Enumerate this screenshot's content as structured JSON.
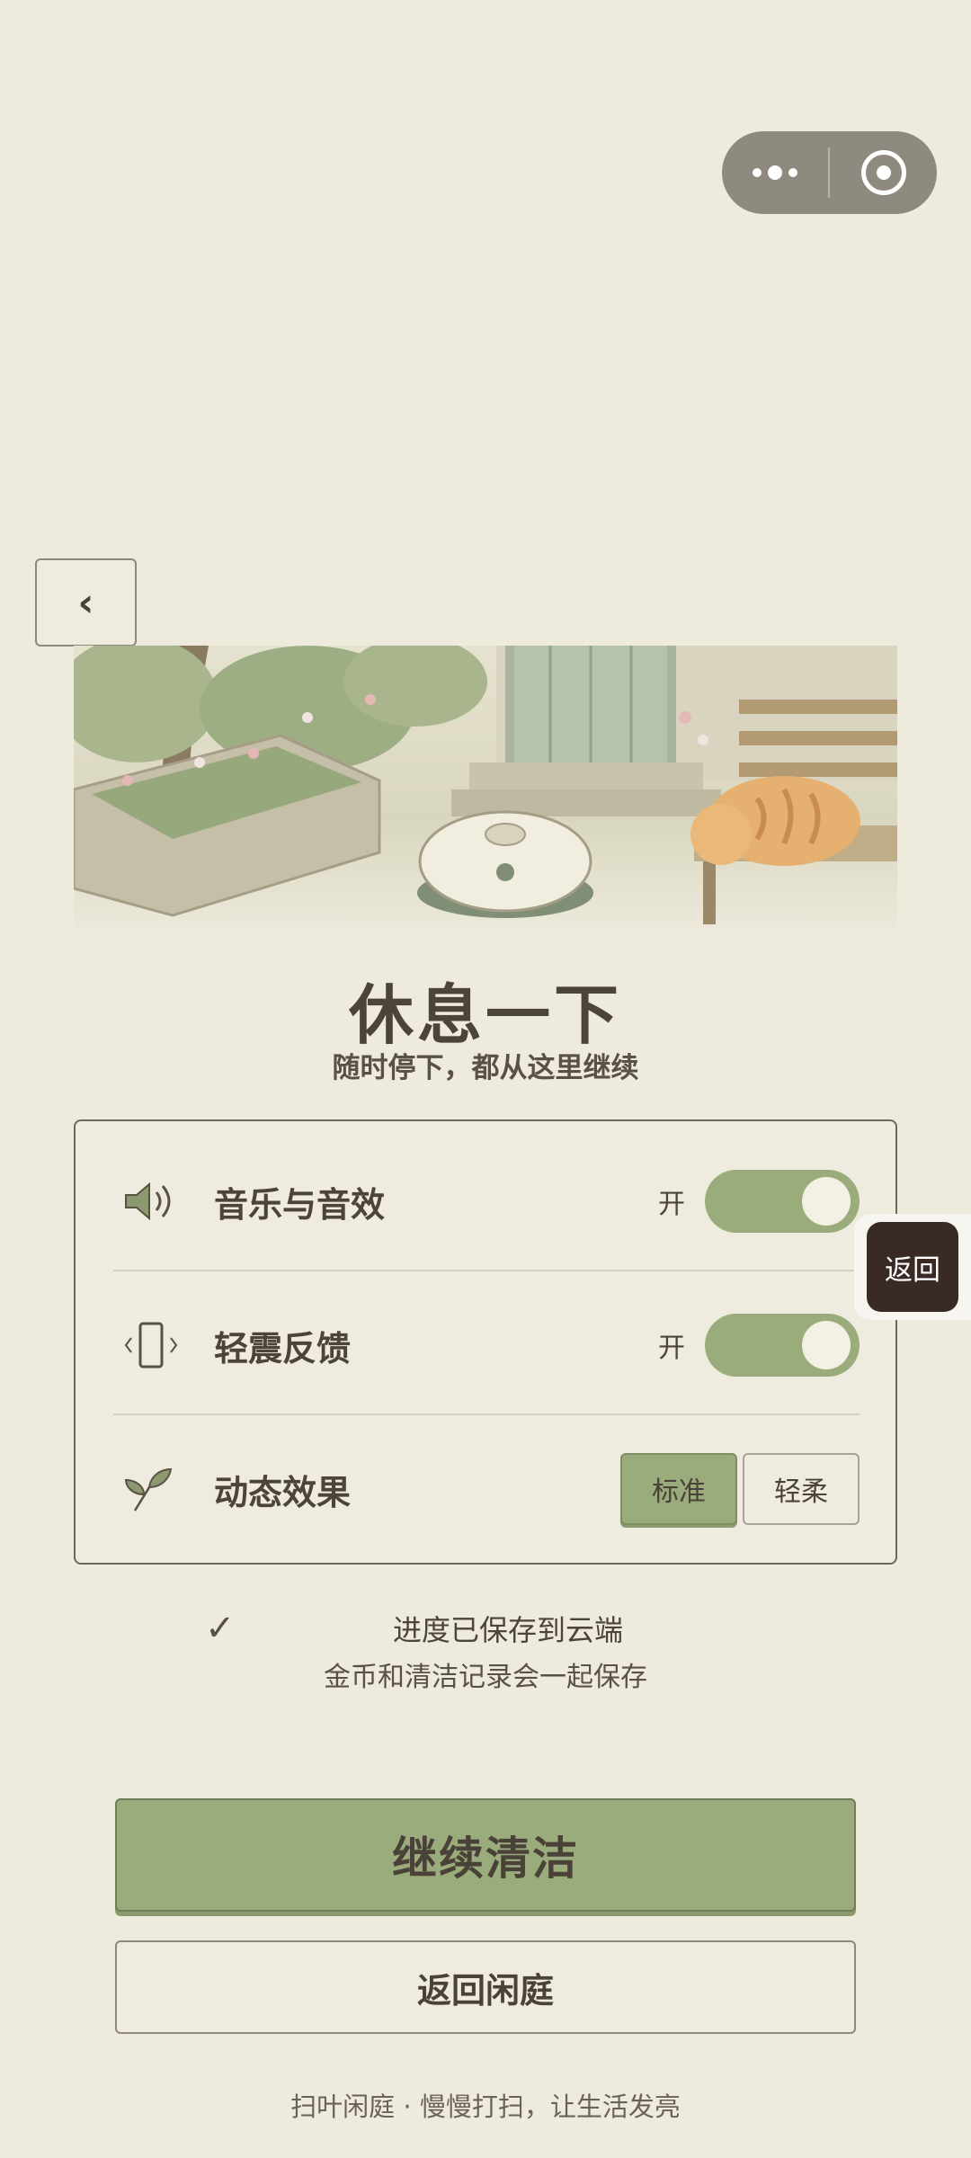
{
  "capsule": {
    "more_icon": "more-dots-icon",
    "close_icon": "target-circle-icon"
  },
  "back_button": {
    "label": "‹"
  },
  "title": "休息一下",
  "subtitle": "随时停下，都从这里继续",
  "settings": {
    "music": {
      "label": "音乐与音效",
      "state": "开",
      "on": true
    },
    "haptics": {
      "label": "轻震反馈",
      "state": "开",
      "on": true
    },
    "motion": {
      "label": "动态效果",
      "options": [
        "标准",
        "轻柔"
      ],
      "selected": "标准"
    }
  },
  "floating_back": {
    "label": "返回"
  },
  "save_status": {
    "check": "✓",
    "main": "进度已保存到云端",
    "sub": "金币和清洁记录会一起保存"
  },
  "buttons": {
    "continue": "继续清洁",
    "back_to_yard": "返回闲庭"
  },
  "footer": "扫叶闲庭 · 慢慢打扫，让生活发亮",
  "colors": {
    "background": "#eeeadc",
    "accent_green": "#9aab7c",
    "text": "#4a4238"
  }
}
